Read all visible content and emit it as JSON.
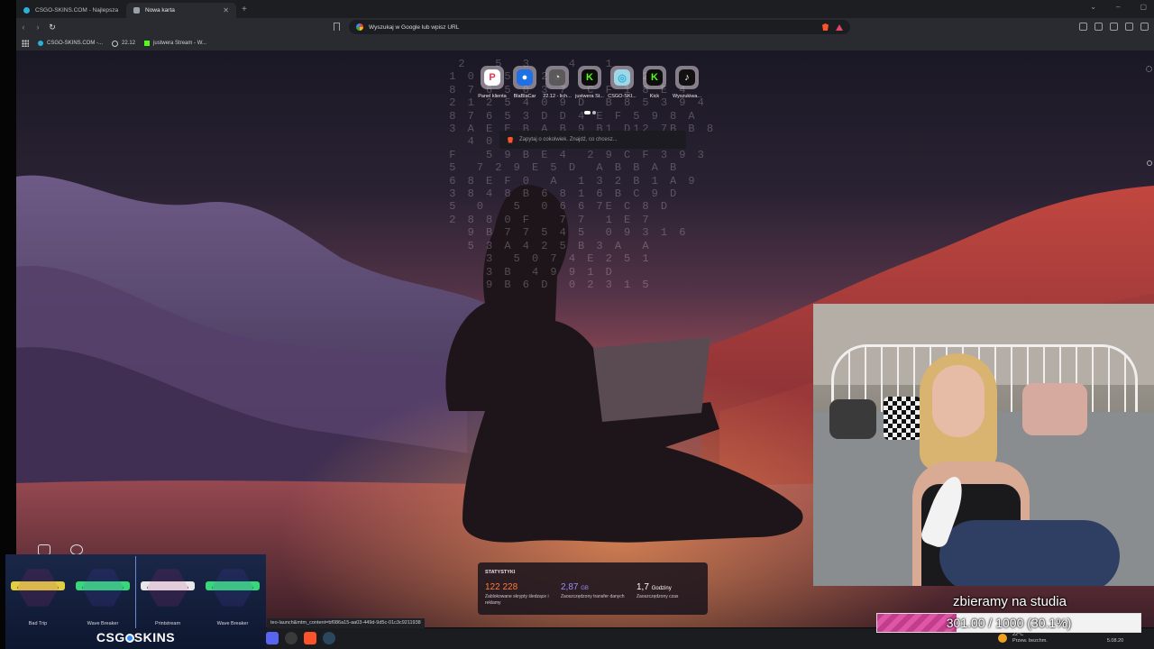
{
  "browser": {
    "tabs": [
      {
        "title": "CSGO-SKINS.COM - Najlepsza Skrzy",
        "active": false,
        "icon": "csgo-skins-favicon"
      },
      {
        "title": "Nowa karta",
        "active": true,
        "icon": "shield-icon"
      }
    ],
    "address_bar": {
      "placeholder": "Wyszukaj w Google lub wpisz URL"
    },
    "bookmarks": [
      {
        "label": "CSGO-SKINS.COM -...",
        "icon": "csgo-skins-favicon"
      },
      {
        "label": "22.12",
        "icon": "clock-icon"
      },
      {
        "label": "justwera Stream - W...",
        "icon": "kick-icon"
      }
    ]
  },
  "new_tab": {
    "top_sites": [
      {
        "label": "Panel klienta",
        "glyph": "P",
        "color": "#e8334a"
      },
      {
        "label": "BlaBlaCar",
        "glyph": "●",
        "color": "#1f6fe5"
      },
      {
        "label": "22.12 - lich...",
        "glyph": "◔",
        "color": "#cccccc"
      },
      {
        "label": "justwera St...",
        "glyph": "K",
        "color": "#53fc18"
      },
      {
        "label": "CSGO-SKI...",
        "glyph": "◎",
        "color": "#2bb0d9"
      },
      {
        "label": "Kick",
        "glyph": "K",
        "color": "#53fc18"
      },
      {
        "label": "Wyszukiwa...",
        "glyph": "♪",
        "color": "#111111"
      }
    ],
    "ask_placeholder": "Zapytaj o cokolwiek. Znajdź, co chcesz...",
    "stats": {
      "header": "STATYSTYKI",
      "items": [
        {
          "value": "122 228",
          "unit": "",
          "label": "Zablokowane skrypty śledzące i reklamy",
          "color": "#ff7a3d"
        },
        {
          "value": "2,87",
          "unit": "GB",
          "label": "Zaoszczędzony transfer danych",
          "color": "#9b8cff"
        },
        {
          "value": "1,7",
          "unit": "Godziny",
          "label": "Zaoszczędzony czas",
          "color": "#ffffff"
        }
      ]
    },
    "matrix_text": "  2   5  3    4   1\n 1 0 0 5 2 2 0  9  C  2\n 8 7 6 5 0 3 7  C F 1 8 E 4\n 2 1 2 5 4 0 9 D  B 8 5 3 9 4\n 8 7 6 5 3 D D 4 E F 5 9 8 A\n 3 A E E B A B 9 B1 D12 7B B 8\n   4 0 8F B  E  3 B B F 9 6\n F   5 9 B E 4  2 9 C F 3 9 3\n 5  7 2 9 E 5 D  A B B A B\n 6 8 E F 0  A  1 3 2 B 1 A 9\n 3 8 4 8 B 6 8 1 6 B C 9 D\n 5  0   5  0 6 6 7E C 8 D\n 2 8 8 0 F   7 7  1 E 7\n   9 B 7 7 5 4 5  0 9 3 1 6\n   5 3 A 4 2 5 B 3 A  A\n     3  5 0 7 4 E 2 5 1\n     3 B  4 9 9 1 D\n     9 B 6 D  0 2 3 1 5"
  },
  "ad": {
    "items": [
      {
        "name": "Bad Trip",
        "color": "#e0d040",
        "frame": "#c0308a"
      },
      {
        "name": "Wave Breaker",
        "color": "#38d878",
        "frame": "#5a4cd0"
      },
      {
        "name": "Printstream",
        "color": "#e8e8e8",
        "frame": "#c0308a"
      },
      {
        "name": "Wave Breaker",
        "color": "#38d878",
        "frame": "#5a4cd0"
      }
    ],
    "brand_left": "CSG",
    "brand_right": "SKINS"
  },
  "status_url": "teo-launch&mtm_content=bf086a15-aa03-449d-9d5c-01c3c9211938",
  "taskbar": {
    "apps": [
      {
        "name": "discord",
        "color": "#5865f2"
      },
      {
        "name": "obs",
        "color": "#3a3a3a"
      },
      {
        "name": "brave",
        "color": "#fb542b"
      },
      {
        "name": "steam",
        "color": "#1b2838"
      }
    ],
    "weather_temp": "22°C",
    "weather_desc": "Przew. bezchm.",
    "time": "",
    "date": "5.08.20"
  },
  "overlay": {
    "goal_title": "zbieramy na studia",
    "goal_text": "301.00 / 1000 (30.1%)",
    "goal_fraction": 0.301
  },
  "colors": {
    "accent_pink": "#d6479c"
  }
}
